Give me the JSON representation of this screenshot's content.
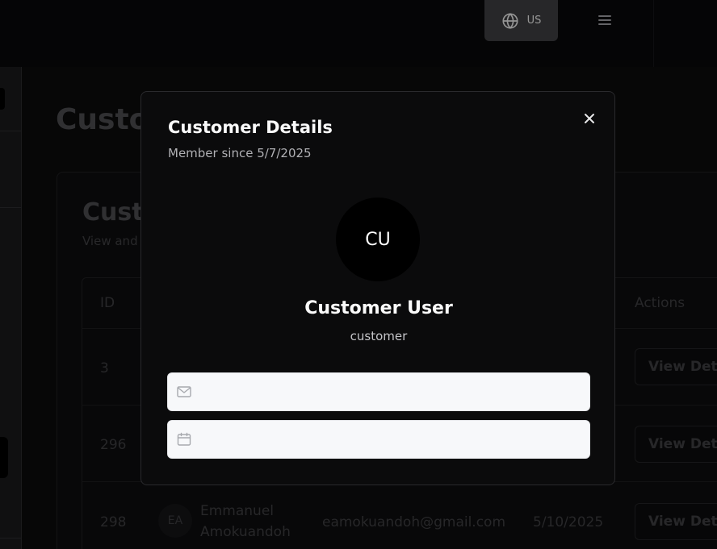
{
  "header": {
    "language_label": "US"
  },
  "page": {
    "title": "Customers"
  },
  "card": {
    "title": "Customers",
    "subtitle": "View and manage customers"
  },
  "table": {
    "columns": [
      "ID",
      "",
      "",
      "",
      "Actions"
    ],
    "rows": [
      {
        "id": "3",
        "initials": "",
        "name": "",
        "email": "",
        "date": "",
        "action": "View Details"
      },
      {
        "id": "296",
        "initials": "",
        "name": "",
        "email": "",
        "date": "",
        "action": "View Details"
      },
      {
        "id": "298",
        "initials": "EA",
        "name_line1": "Emmanuel",
        "name_line2": "Amokuandoh",
        "email": "eamokuandoh@gmail.com",
        "date": "5/10/2025",
        "action": "View Details"
      }
    ]
  },
  "modal": {
    "title": "Customer Details",
    "subtitle": "Member since 5/7/2025",
    "avatar_initials": "CU",
    "name": "Customer User",
    "role": "customer",
    "email_value": "",
    "date_value": "",
    "icons": {
      "close": "close-icon",
      "email": "mail-icon",
      "date": "calendar-icon"
    }
  },
  "colors": {
    "backdrop": "#0a0a0b",
    "modal_bg": "#0b0b0c",
    "field_bg": "#f7f8fa"
  }
}
